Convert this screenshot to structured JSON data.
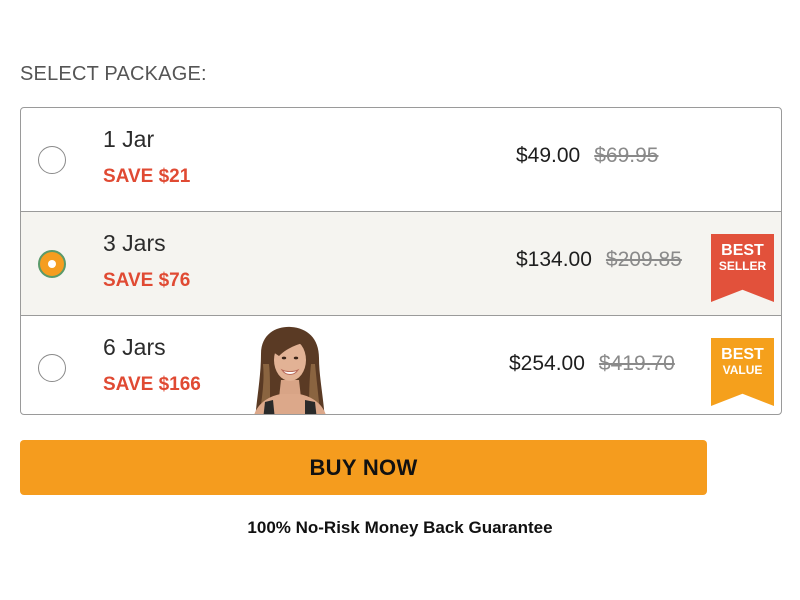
{
  "section_title": "SELECT PACKAGE:",
  "packages": [
    {
      "name": "1 Jar",
      "save": "SAVE $21",
      "price": "$49.00",
      "old_price": "$69.95",
      "selected": false
    },
    {
      "name": "3 Jars",
      "save": "SAVE $76",
      "price": "$134.00",
      "old_price": "$209.85",
      "selected": true,
      "ribbon": {
        "line1": "BEST",
        "line2": "SELLER",
        "color": "#e2513b"
      }
    },
    {
      "name": "6 Jars",
      "save": "SAVE $166",
      "price": "$254.00",
      "old_price": "$419.70",
      "selected": false,
      "ribbon": {
        "line1": "BEST",
        "line2": "VALUE",
        "color": "#f5a01c"
      }
    }
  ],
  "buy_button": "BUY NOW",
  "guarantee": "100% No-Risk Money Back Guarantee",
  "colors": {
    "accent": "#f59c1e",
    "save_red": "#e04a33",
    "selected_bg": "#f5f4f0"
  }
}
